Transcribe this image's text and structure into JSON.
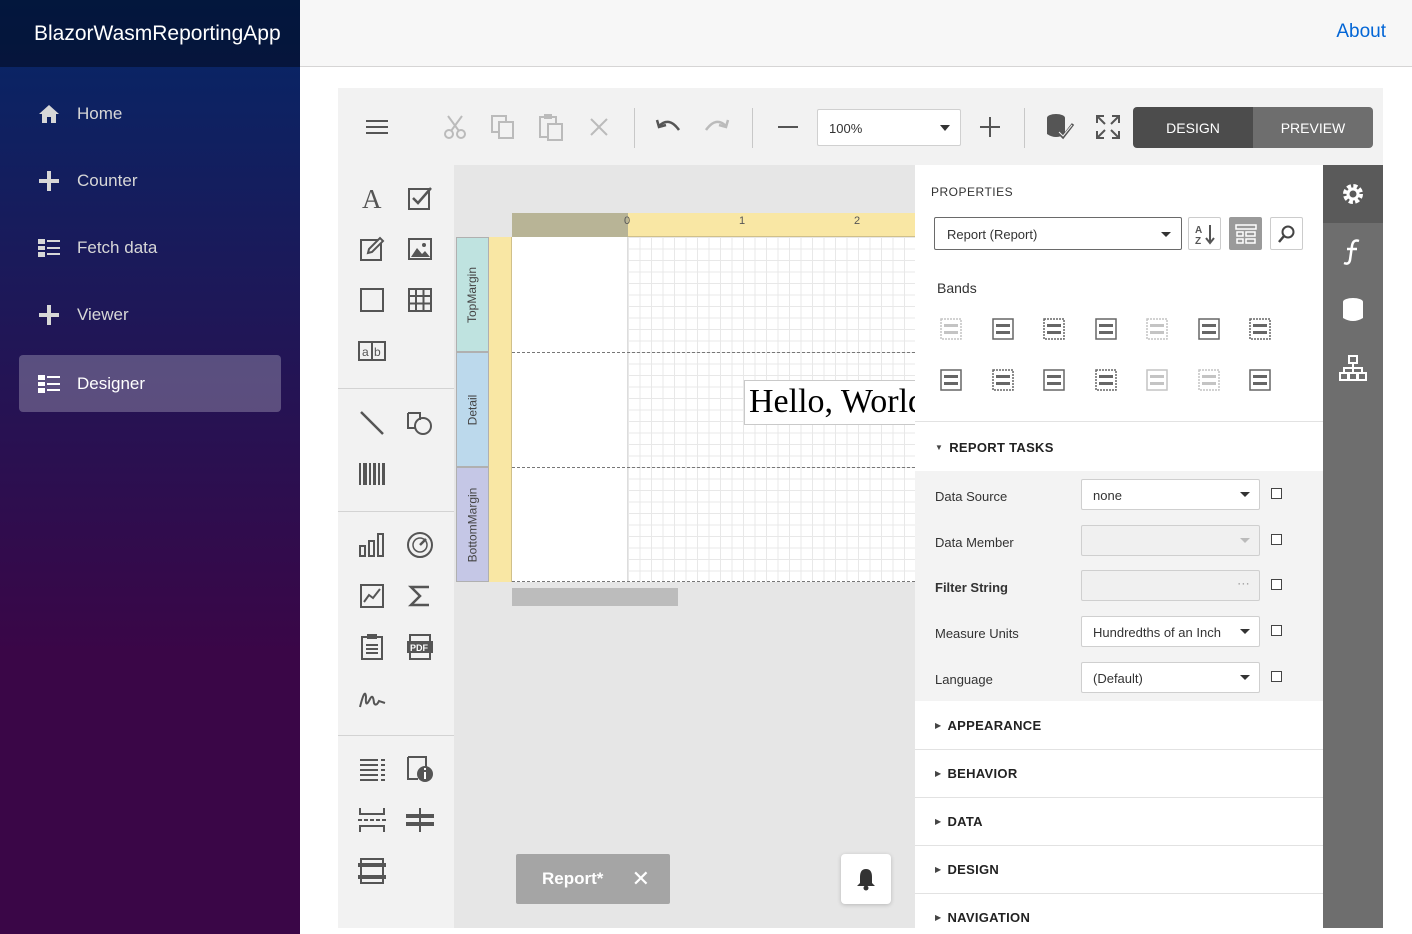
{
  "app": {
    "title": "BlazorWasmReportingApp"
  },
  "nav": [
    {
      "label": "Home",
      "icon": "home-icon"
    },
    {
      "label": "Counter",
      "icon": "plus-icon"
    },
    {
      "label": "Fetch data",
      "icon": "list-icon"
    },
    {
      "label": "Viewer",
      "icon": "plus-icon"
    },
    {
      "label": "Designer",
      "icon": "list-icon",
      "active": true
    }
  ],
  "topbar": {
    "about": "About"
  },
  "toolbar": {
    "zoom": "100%",
    "design": "DESIGN",
    "preview": "PREVIEW"
  },
  "surface": {
    "ruler_ticks": [
      "0",
      "1",
      "2"
    ],
    "bands": [
      "TopMargin",
      "Detail",
      "BottomMargin"
    ],
    "text": "Hello, World!",
    "tab_label": "Report*",
    "tab_close": "✕"
  },
  "properties": {
    "title": "PROPERTIES",
    "selected": "Report (Report)",
    "bands_label": "Bands",
    "report_tasks": "REPORT TASKS",
    "rows": [
      {
        "label": "Data Source",
        "value": "none",
        "bold": false,
        "disabled": false
      },
      {
        "label": "Data Member",
        "value": "",
        "bold": false,
        "disabled": true
      },
      {
        "label": "Filter String",
        "value": "",
        "bold": true,
        "disabled": true
      },
      {
        "label": "Measure Units",
        "value": "Hundredths of an Inch",
        "bold": false,
        "disabled": false
      },
      {
        "label": "Language",
        "value": "(Default)",
        "bold": false,
        "disabled": false
      }
    ],
    "sections": [
      "APPEARANCE",
      "BEHAVIOR",
      "DATA",
      "DESIGN",
      "NAVIGATION"
    ]
  },
  "colors": {
    "sidebar_top": "#052767",
    "sidebar_bottom": "#3a0647",
    "link": "#0366d6",
    "design_btn": "#4c4c4c"
  }
}
